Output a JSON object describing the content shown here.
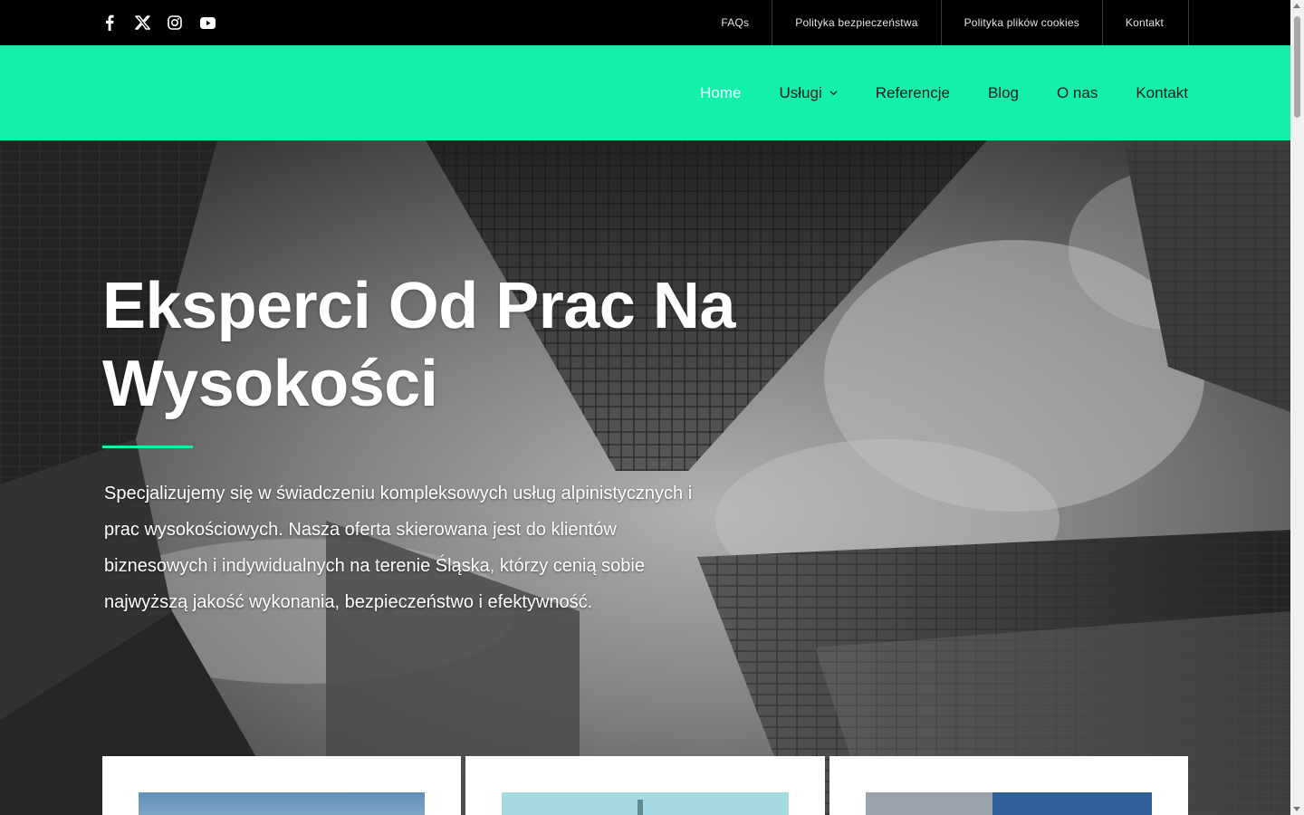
{
  "topbar": {
    "social": [
      "facebook-icon",
      "x-icon",
      "instagram-icon",
      "youtube-icon"
    ],
    "links": [
      {
        "label": "FAQs"
      },
      {
        "label": "Polityka bezpieczeństwa"
      },
      {
        "label": "Polityka plików cookies"
      },
      {
        "label": "Kontakt"
      }
    ]
  },
  "nav": {
    "items": [
      {
        "label": "Home"
      },
      {
        "label": "Usługi"
      },
      {
        "label": "Referencje"
      },
      {
        "label": "Blog"
      },
      {
        "label": "O nas"
      },
      {
        "label": "Kontakt"
      }
    ],
    "active": "Home"
  },
  "hero": {
    "title": "Eksperci Od Prac Na Wysokości",
    "text": "Specjalizujemy się w świadczeniu kompleksowych usług alpinistycznych i prac wysokościowych. Nasza oferta skierowana jest do klientów biznesowych i indywidualnych na terenie Śląska, którzy cenią sobie najwyższą jakość wykonania, bezpieczeństwo i efektywność."
  },
  "colors": {
    "accent": "#13f0ab",
    "topbar": "#000000"
  }
}
